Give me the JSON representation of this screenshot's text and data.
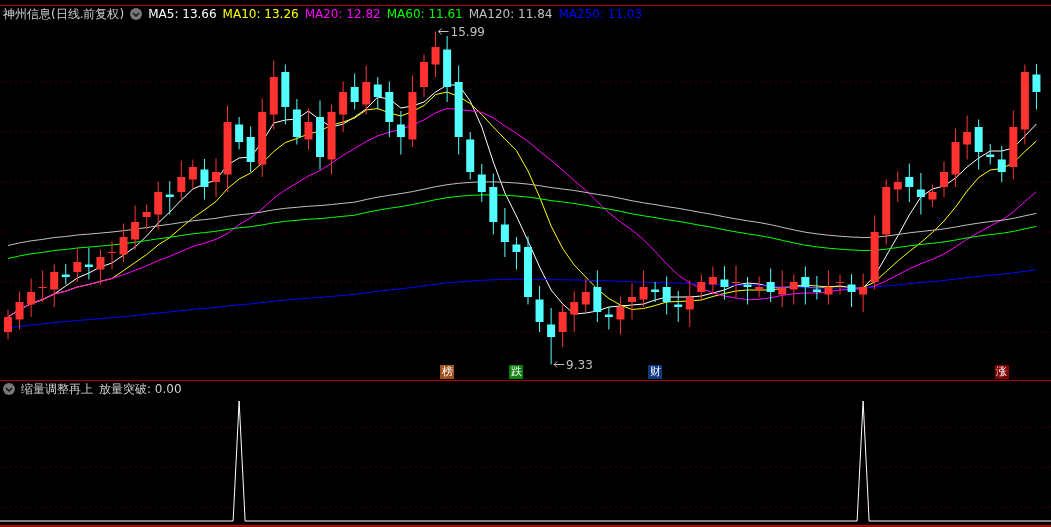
{
  "chart": {
    "title": "神州信息(日线.前复权)",
    "ma_legend": [
      {
        "label": "MA5: 13.66",
        "color": "#ffffff"
      },
      {
        "label": "MA10: 13.26",
        "color": "#ffff00"
      },
      {
        "label": "MA20: 12.82",
        "color": "#ff00ff"
      },
      {
        "label": "MA60: 11.61",
        "color": "#00ff00"
      },
      {
        "label": "MA120: 11.84",
        "color": "#c0c0c0"
      },
      {
        "label": "MA250: 11.03",
        "color": "#0000ff"
      }
    ],
    "high_label": "15.99",
    "low_label": "9.33",
    "markers": [
      {
        "text": "榜",
        "color": "#a0501a"
      },
      {
        "text": "跌",
        "color": "#108010"
      },
      {
        "text": "财",
        "color": "#103a80"
      },
      {
        "text": "涨",
        "color": "#800000"
      }
    ]
  },
  "indicator": {
    "title": "缩量调整再上",
    "reading": "放量突破: 0.00"
  }
}
